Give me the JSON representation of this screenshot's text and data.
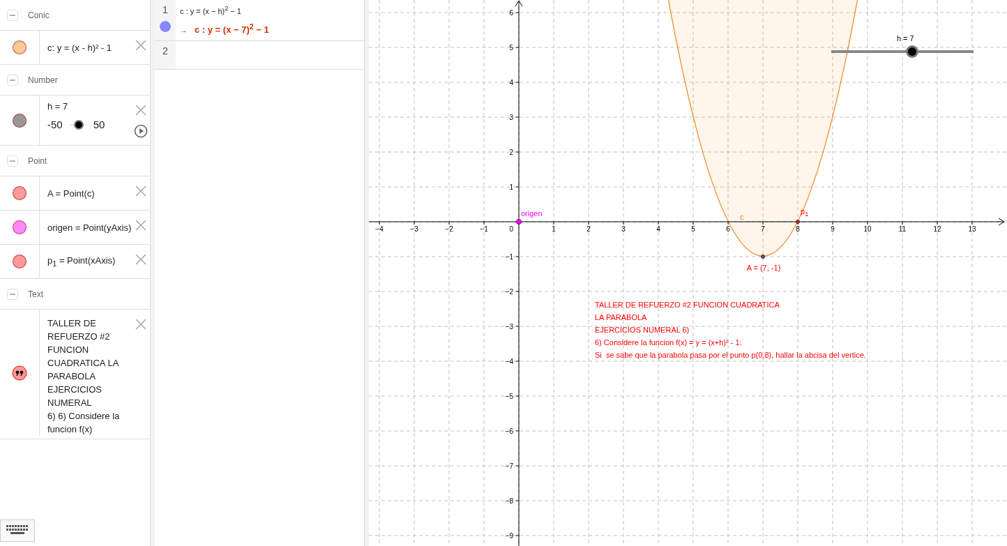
{
  "algebra": {
    "groups": [
      {
        "title": "Conic",
        "items": [
          {
            "kind": "formula",
            "color": "#ffc999",
            "text": "c: y = (x - h)² - 1"
          }
        ]
      },
      {
        "title": "Number",
        "items": [
          {
            "kind": "slider",
            "color": "#999999",
            "text": "h = 7",
            "min": "-50",
            "max": "50",
            "level": 0.57
          }
        ]
      },
      {
        "title": "Point",
        "items": [
          {
            "kind": "formula",
            "color": "#ff9999",
            "text": "A = Point(c)"
          },
          {
            "kind": "formula",
            "color": "#ff88ff",
            "text": "origen = Point(yAxis)"
          },
          {
            "kind": "formula",
            "color": "#ff9999",
            "text": "p$_{1}$ = Point(xAxis)"
          }
        ]
      },
      {
        "title": "Text",
        "items": [
          {
            "kind": "text",
            "color": "#ff9999",
            "text": "TALLER DE REFUERZO #2 FUNCION CUADRATICA LA PARABOLA EJERCICIOS NUMERAL",
            "caption": "6) 6) Considere la funcion f(x)"
          }
        ]
      }
    ]
  },
  "cas": {
    "rows": [
      {
        "number": "1",
        "shown": true,
        "input": "c : y = (x − h)$^{2}$ − 1",
        "arrow": "→",
        "output": "c : y = (x − 7)$^{2}$ − 1"
      },
      {
        "number": "2"
      }
    ]
  },
  "graphics": {
    "x_ticks": [
      "−4",
      "−3",
      "−2",
      "−1",
      "0",
      "1",
      "2",
      "3",
      "4",
      "5",
      "6",
      "7",
      "8",
      "9",
      "10",
      "11",
      "12",
      "13"
    ],
    "y_ticks": [
      "6",
      "5",
      "4",
      "3",
      "2",
      "1",
      "−1",
      "−2",
      "−3",
      "−4",
      "−5",
      "−6",
      "−7",
      "−8",
      "−9"
    ],
    "labels": [
      {
        "kind": "origen",
        "text": "origen"
      },
      {
        "kind": "curve",
        "text": "c"
      },
      {
        "kind": "p1",
        "text": "p$_{1}$"
      },
      {
        "kind": "vertex",
        "text": "A = (7, -1)"
      }
    ],
    "slider": {
      "label": "h = 7",
      "level": 0.57
    },
    "text_lines": [
      "TALLER DE REFUERZO #2 FUNCION CUADRATICA",
      "LA PARABOLA",
      "EJERCICIOS NUMERAL 6)",
      "6) Considere la funcion f(x) = y = (x+h)² - 1:",
      "Si  se sabe que la parabola pasa por el punto p(0,8), hallar la abcisa del vertice."
    ]
  }
}
